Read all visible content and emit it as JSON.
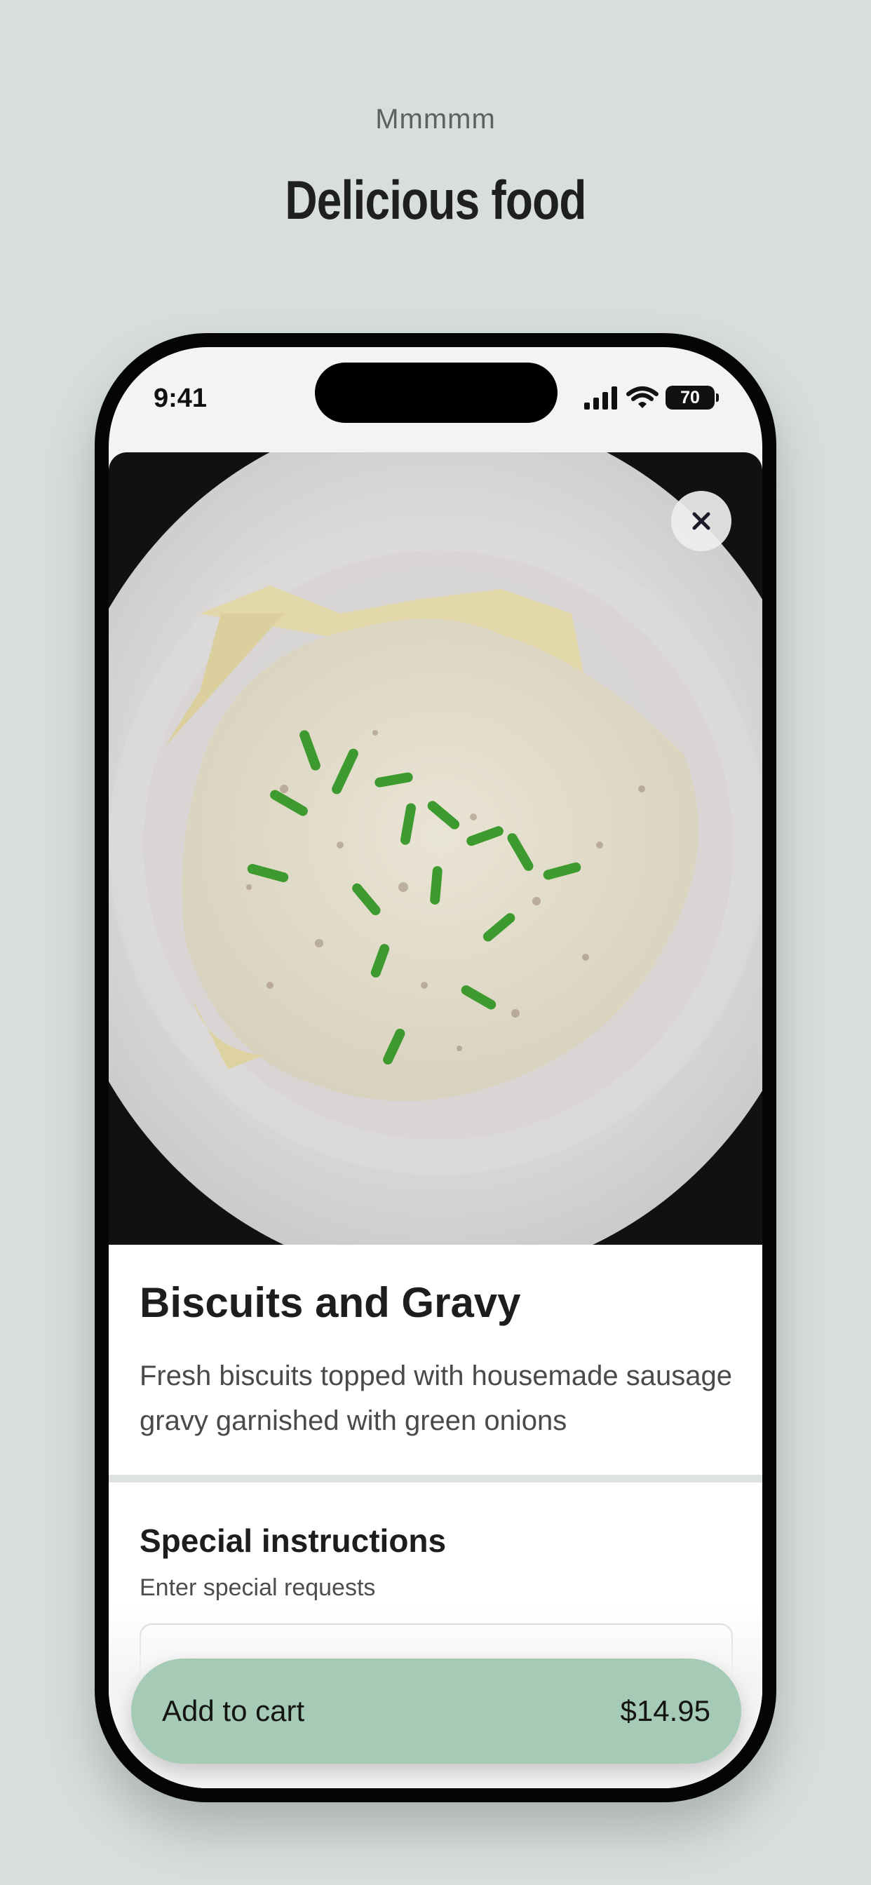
{
  "header": {
    "eyebrow": "Mmmmm",
    "title": "Delicious food"
  },
  "status_bar": {
    "time": "9:41",
    "battery": "70"
  },
  "item": {
    "name": "Biscuits and Gravy",
    "description": "Fresh biscuits topped with housemade sausage gravy garnished with green onions"
  },
  "special_instructions": {
    "title": "Special instructions",
    "subtitle": "Enter special requests",
    "value": ""
  },
  "cart": {
    "label": "Add to cart",
    "price": "$14.95"
  },
  "colors": {
    "page_background": "#d8dfdb",
    "cart_button": "#a5cbb6",
    "divider": "#dde2df"
  },
  "icons": {
    "close": "close-icon",
    "signal": "signal-icon",
    "wifi": "wifi-icon",
    "battery": "battery-icon"
  }
}
